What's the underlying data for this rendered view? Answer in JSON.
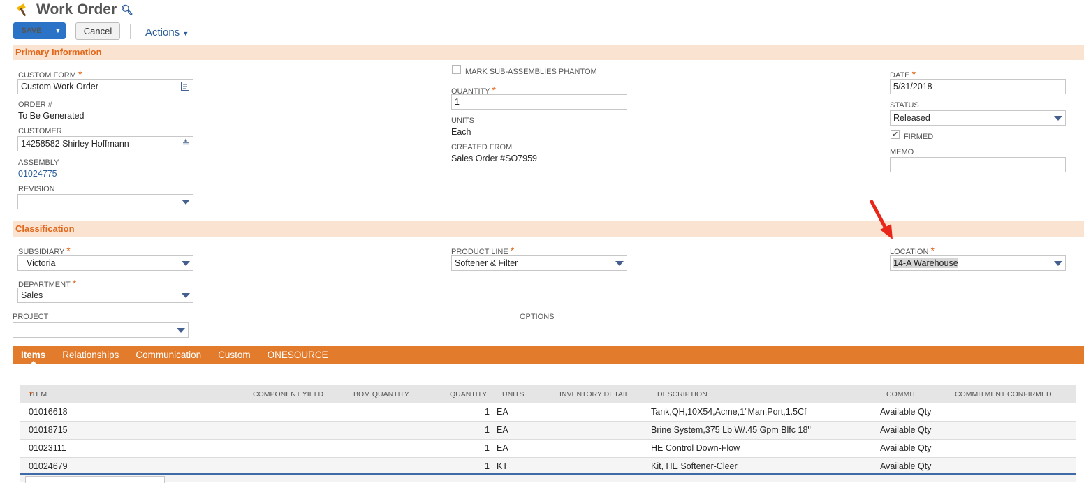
{
  "header": {
    "title": "Work Order"
  },
  "toolbar": {
    "save_label": "Save",
    "cancel_label": "Cancel",
    "actions_label": "Actions"
  },
  "primary": {
    "section_title": "Primary Information",
    "custom_form": {
      "label": "CUSTOM FORM",
      "value": "Custom Work Order"
    },
    "order_no": {
      "label": "ORDER #",
      "value": "To Be Generated"
    },
    "customer": {
      "label": "CUSTOMER",
      "value": "14258582 Shirley Hoffmann"
    },
    "assembly": {
      "label": "ASSEMBLY",
      "value": "01024775"
    },
    "revision": {
      "label": "REVISION",
      "value": ""
    },
    "mark_phantom": {
      "label": "MARK SUB-ASSEMBLIES PHANTOM",
      "checked": false
    },
    "quantity": {
      "label": "QUANTITY",
      "value": "1"
    },
    "units": {
      "label": "UNITS",
      "value": "Each"
    },
    "created_from": {
      "label": "CREATED FROM",
      "value": "Sales Order #SO7959"
    },
    "date": {
      "label": "DATE",
      "value": "5/31/2018"
    },
    "status": {
      "label": "STATUS",
      "value": "Released"
    },
    "firmed": {
      "label": "FIRMED",
      "checked": true
    },
    "memo": {
      "label": "MEMO",
      "value": ""
    }
  },
  "classification": {
    "section_title": "Classification",
    "subsidiary": {
      "label": "SUBSIDIARY",
      "value": "Victoria"
    },
    "department": {
      "label": "DEPARTMENT",
      "value": "Sales"
    },
    "project": {
      "label": "PROJECT",
      "value": ""
    },
    "product_line": {
      "label": "PRODUCT LINE",
      "value": "Softener & Filter"
    },
    "options": {
      "label": "OPTIONS"
    },
    "location": {
      "label": "LOCATION",
      "value": "14-A Warehouse"
    }
  },
  "tabs": [
    {
      "label": "Items",
      "active": true
    },
    {
      "label": "Relationships"
    },
    {
      "label": "Communication"
    },
    {
      "label": "Custom"
    },
    {
      "label": "ONESOURCE"
    }
  ],
  "items": {
    "columns": [
      "ITEM",
      "COMPONENT YIELD",
      "BOM QUANTITY",
      "QUANTITY",
      "UNITS",
      "INVENTORY DETAIL",
      "DESCRIPTION",
      "COMMIT",
      "COMMITMENT CONFIRMED"
    ],
    "rows": [
      {
        "item": "01016618",
        "quantity": "1",
        "units": "EA",
        "description": "Tank,QH,10X54,Acme,1\"Man,Port,1.5Cf",
        "commit": "Available Qty"
      },
      {
        "item": "01018715",
        "quantity": "1",
        "units": "EA",
        "description": "Brine System,375 Lb W/.45 Gpm Blfc 18\"",
        "commit": "Available Qty"
      },
      {
        "item": "01023111",
        "quantity": "1",
        "units": "EA",
        "description": "HE Control Down-Flow",
        "commit": "Available Qty"
      },
      {
        "item": "01024679",
        "quantity": "1",
        "units": "KT",
        "description": "Kit, HE Softener-Cleer",
        "commit": "Available Qty"
      }
    ]
  },
  "colors": {
    "accent": "#e27b2c",
    "section_bg": "#fae3d0",
    "primary_button": "#2a73c7",
    "link": "#2a5c9a",
    "annotation_arrow": "#e8261a"
  },
  "icons": {
    "title": "hammer-icon",
    "search": "search-icon",
    "form": "form-edit-icon",
    "customer": "double-chevron-icon",
    "annotation": "red-arrow-icon"
  }
}
